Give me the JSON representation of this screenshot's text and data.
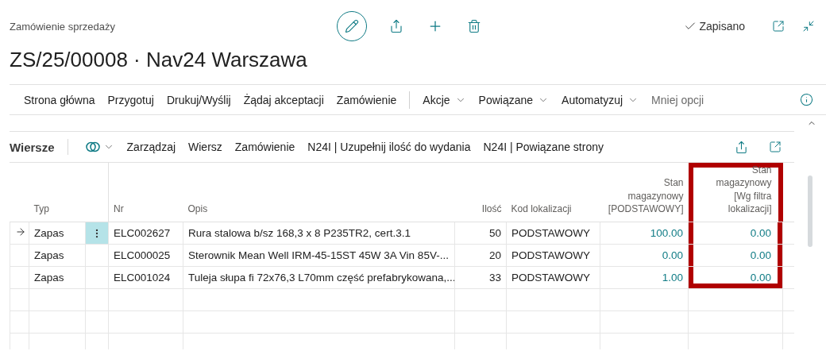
{
  "page": {
    "caption": "Zamówienie sprzedaży",
    "title": "ZS/25/00008 · Nav24 Warszawa",
    "status": "Zapisano"
  },
  "action_bar": [
    {
      "items": [
        {
          "label": "Strona główna",
          "has_menu": false,
          "dimmed": false
        },
        {
          "label": "Przygotuj",
          "has_menu": false,
          "dimmed": false
        },
        {
          "label": "Drukuj/Wyślij",
          "has_menu": false,
          "dimmed": false
        },
        {
          "label": "Żądaj akceptacji",
          "has_menu": false,
          "dimmed": false
        },
        {
          "label": "Zamówienie",
          "has_menu": false,
          "dimmed": false
        }
      ]
    },
    {
      "items": [
        {
          "label": "Akcje",
          "has_menu": true,
          "dimmed": false
        },
        {
          "label": "Powiązane",
          "has_menu": true,
          "dimmed": false
        },
        {
          "label": "Automatyzuj",
          "has_menu": true,
          "dimmed": false
        },
        {
          "label": "Mniej opcji",
          "has_menu": false,
          "dimmed": true
        }
      ]
    }
  ],
  "lines": {
    "title": "Wiersze",
    "actions": [
      "Zarządzaj",
      "Wiersz",
      "Zamówienie",
      "N24I | Uzupełnij ilość do wydania",
      "N24I | Powiązane strony"
    ],
    "columns": [
      {
        "label": "Typ",
        "kind": "text",
        "highlighted": false
      },
      {
        "label": "Nr",
        "kind": "text",
        "highlighted": false
      },
      {
        "label": "Opis",
        "kind": "text",
        "highlighted": false
      },
      {
        "label": "Ilość",
        "kind": "number",
        "highlighted": false
      },
      {
        "label": "Kod lokalizacji",
        "kind": "text",
        "highlighted": false
      },
      {
        "label": "Stan\nmagazynowy\n[PODSTAWOWY]",
        "kind": "link",
        "highlighted": false
      },
      {
        "label": "Stan magazynowy\n[Wg filtra\nlokalizacji]",
        "kind": "link",
        "highlighted": true
      }
    ],
    "rows": [
      {
        "selected": true,
        "cells": [
          "Zapas",
          "ELC002627",
          "Rura stalowa b/sz 168,3 x 8 P235TR2, cert.3.1",
          "50",
          "PODSTAWOWY",
          "100.00",
          "0.00"
        ]
      },
      {
        "selected": false,
        "cells": [
          "Zapas",
          "ELC000025",
          "Sterownik Mean Well IRM-45-15ST 45W 3A Vin 85V-...",
          "20",
          "PODSTAWOWY",
          "0.00",
          "0.00"
        ]
      },
      {
        "selected": false,
        "cells": [
          "Zapas",
          "ELC001024",
          "Tuleja słupa fi 72x76,3 L70mm część prefabrykowana,...",
          "33",
          "PODSTAWOWY",
          "1.00",
          "0.00"
        ]
      }
    ]
  }
}
